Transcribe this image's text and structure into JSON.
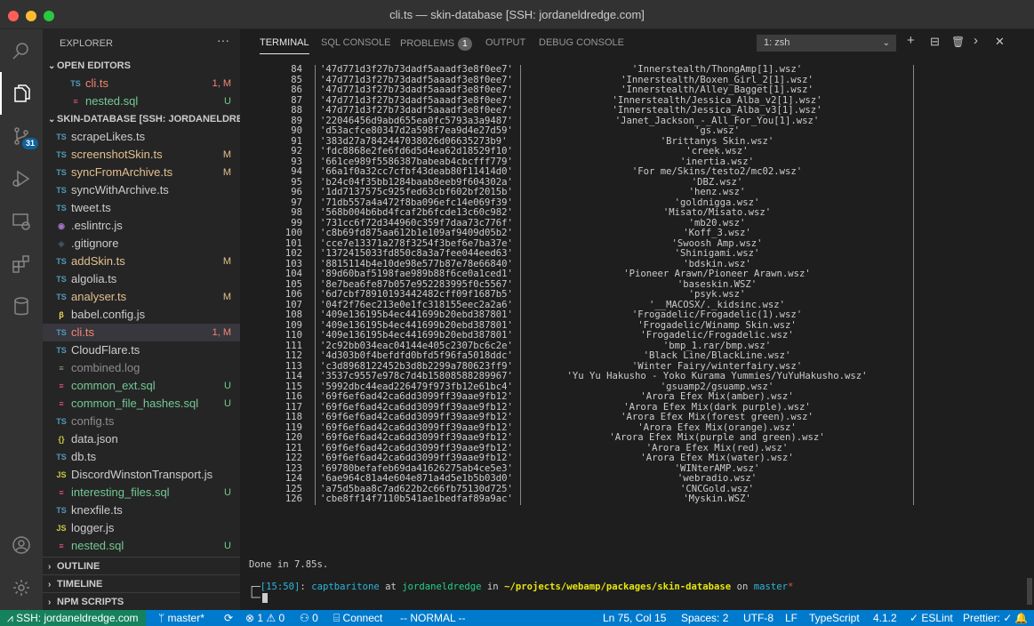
{
  "window": {
    "title": "cli.ts — skin-database [SSH: jordaneldredge.com]"
  },
  "activity_bar": {
    "scm_badge": "31"
  },
  "explorer": {
    "title": "EXPLORER",
    "more": "···",
    "open_editors_title": "OPEN EDITORS",
    "open_editors": [
      {
        "icon": "TS",
        "name": "cli.ts",
        "status": "1, M",
        "kind": "ts",
        "state": "err"
      },
      {
        "icon": "≡",
        "name": "nested.sql",
        "status": "U",
        "kind": "sql",
        "state": "unt"
      }
    ],
    "workspace_title": "SKIN-DATABASE [SSH: JORDANELDRE...",
    "files": [
      {
        "icon": "TS",
        "name": "scrapeLikes.ts",
        "status": "",
        "kind": "ts",
        "state": ""
      },
      {
        "icon": "TS",
        "name": "screenshotSkin.ts",
        "status": "M",
        "kind": "ts",
        "state": "mod"
      },
      {
        "icon": "TS",
        "name": "syncFromArchive.ts",
        "status": "M",
        "kind": "ts",
        "state": "mod"
      },
      {
        "icon": "TS",
        "name": "syncWithArchive.ts",
        "status": "",
        "kind": "ts",
        "state": ""
      },
      {
        "icon": "TS",
        "name": "tweet.ts",
        "status": "",
        "kind": "ts",
        "state": ""
      },
      {
        "icon": "◉",
        "name": ".eslintrc.js",
        "status": "",
        "kind": "esl",
        "state": ""
      },
      {
        "icon": "◈",
        "name": ".gitignore",
        "status": "",
        "kind": "git",
        "state": ""
      },
      {
        "icon": "TS",
        "name": "addSkin.ts",
        "status": "M",
        "kind": "ts",
        "state": "mod"
      },
      {
        "icon": "TS",
        "name": "algolia.ts",
        "status": "",
        "kind": "ts",
        "state": ""
      },
      {
        "icon": "TS",
        "name": "analyser.ts",
        "status": "M",
        "kind": "ts",
        "state": "mod"
      },
      {
        "icon": "β",
        "name": "babel.config.js",
        "status": "",
        "kind": "bab",
        "state": ""
      },
      {
        "icon": "TS",
        "name": "cli.ts",
        "status": "1, M",
        "kind": "ts",
        "state": "err",
        "selected": true
      },
      {
        "icon": "TS",
        "name": "CloudFlare.ts",
        "status": "",
        "kind": "ts",
        "state": ""
      },
      {
        "icon": "≡",
        "name": "combined.log",
        "status": "",
        "kind": "log",
        "state": "dim"
      },
      {
        "icon": "≡",
        "name": "common_ext.sql",
        "status": "U",
        "kind": "sql",
        "state": "unt"
      },
      {
        "icon": "≡",
        "name": "common_file_hashes.sql",
        "status": "U",
        "kind": "sql",
        "state": "unt"
      },
      {
        "icon": "TS",
        "name": "config.ts",
        "status": "",
        "kind": "ts",
        "state": "dim"
      },
      {
        "icon": "{}",
        "name": "data.json",
        "status": "",
        "kind": "json",
        "state": ""
      },
      {
        "icon": "TS",
        "name": "db.ts",
        "status": "",
        "kind": "ts",
        "state": ""
      },
      {
        "icon": "JS",
        "name": "DiscordWinstonTransport.js",
        "status": "",
        "kind": "js",
        "state": ""
      },
      {
        "icon": "≡",
        "name": "interesting_files.sql",
        "status": "U",
        "kind": "sql",
        "state": "unt"
      },
      {
        "icon": "TS",
        "name": "knexfile.ts",
        "status": "",
        "kind": "ts",
        "state": ""
      },
      {
        "icon": "JS",
        "name": "logger.js",
        "status": "",
        "kind": "js",
        "state": ""
      },
      {
        "icon": "≡",
        "name": "nested.sql",
        "status": "U",
        "kind": "sql",
        "state": "unt"
      }
    ],
    "outline_title": "OUTLINE",
    "timeline_title": "TIMELINE",
    "npm_title": "NPM SCRIPTS"
  },
  "panel": {
    "tabs": [
      {
        "label": "TERMINAL"
      },
      {
        "label": "SQL CONSOLE"
      },
      {
        "label": "PROBLEMS"
      },
      {
        "label": "OUTPUT"
      },
      {
        "label": "DEBUG CONSOLE"
      }
    ],
    "problems_count": "1",
    "shell": "1: zsh"
  },
  "terminal": {
    "rows": [
      {
        "n": "84",
        "h": "'47d771d3f27b73dadf5aaadf3e8f0ee7'",
        "f": "'Innerstealth/ThongAmp[1].wsz'"
      },
      {
        "n": "85",
        "h": "'47d771d3f27b73dadf5aaadf3e8f0ee7'",
        "f": "'Innerstealth/Boxen_Girl_2[1].wsz'"
      },
      {
        "n": "86",
        "h": "'47d771d3f27b73dadf5aaadf3e8f0ee7'",
        "f": "'Innerstealth/Alley_Bagget[1].wsz'"
      },
      {
        "n": "87",
        "h": "'47d771d3f27b73dadf5aaadf3e8f0ee7'",
        "f": "'Innerstealth/Jessica_Alba_v2[1].wsz'"
      },
      {
        "n": "88",
        "h": "'47d771d3f27b73dadf5aaadf3e8f0ee7'",
        "f": "'Innerstealth/Jessica_Alba_v3[1].wsz'"
      },
      {
        "n": "89",
        "h": "'22046456d9abd655ea0fc5793a3a9487'",
        "f": "'Janet_Jackson_-_All_For_You[1].wsz'"
      },
      {
        "n": "90",
        "h": "'d53acfce80347d2a598f7ea9d4e27d59'",
        "f": "'gs.wsz'"
      },
      {
        "n": "91",
        "h": "'383d27a7842447038026d06635273b9'",
        "f": "'Brittanys Skin.wsz'"
      },
      {
        "n": "92",
        "h": "'fdc8868e2fe6fd6d5d4ea62d18529f10'",
        "f": "'creek.wsz'"
      },
      {
        "n": "93",
        "h": "'661ce989f5586387babeab4cbcfff779'",
        "f": "'inertia.wsz'"
      },
      {
        "n": "94",
        "h": "'66a1f0a32cc7cfbf43deab80f11414d0'",
        "f": "'For me/Skins/testo2/mc02.wsz'"
      },
      {
        "n": "95",
        "h": "'b24c04f35bb1284baab8eeb9f604302a'",
        "f": "'DBZ.wsz'"
      },
      {
        "n": "96",
        "h": "'1dd7137575c925fed63cbf602bf2015b'",
        "f": "'henz.wsz'"
      },
      {
        "n": "97",
        "h": "'71db557a4a472f8ba096efc14e069f39'",
        "f": "'goldnigga.wsz'"
      },
      {
        "n": "98",
        "h": "'568b004b6bd4fcaf2b6fcde13c60c982'",
        "f": "'Misato/Misato.wsz'"
      },
      {
        "n": "99",
        "h": "'731cc6f72d344960c359f7daa73c776f'",
        "f": "'mb20.wsz'"
      },
      {
        "n": "100",
        "h": "'c8b69fd875aa612b1e109af9409d05b2'",
        "f": "'Koff_3.wsz'"
      },
      {
        "n": "101",
        "h": "'cce7e13371a278f3254f3bef6e7ba37e'",
        "f": "'Swoosh Amp.wsz'"
      },
      {
        "n": "102",
        "h": "'1372415033fd850c8a3a7fee044eed63'",
        "f": "'Shinigami.wsz'"
      },
      {
        "n": "103",
        "h": "'8815114b4e10de98e577b87e78e66840'",
        "f": "'bdskin.wsz'"
      },
      {
        "n": "104",
        "h": "'89d60baf5198fae989b88f6ce0a1ced1'",
        "f": "'Pioneer Arawn/Pioneer Arawn.wsz'"
      },
      {
        "n": "105",
        "h": "'8e7bea6fe87b057e952283995f0c5567'",
        "f": "'baseskin.WSZ'"
      },
      {
        "n": "106",
        "h": "'6d7cbf78910193442482cff09f1687b5'",
        "f": "'psyk.wsz'"
      },
      {
        "n": "107",
        "h": "'04f2f76ec213e0e1fc318155eec2a2a6'",
        "f": "'__MACOSX/._kidsinc.wsz'"
      },
      {
        "n": "108",
        "h": "'409e136195b4ec441699b20ebd387801'",
        "f": "'Frogadelic/Frogadelic(1).wsz'"
      },
      {
        "n": "109",
        "h": "'409e136195b4ec441699b20ebd387801'",
        "f": "'Frogadelic/Winamp Skin.wsz'"
      },
      {
        "n": "110",
        "h": "'409e136195b4ec441699b20ebd387801'",
        "f": "'Frogadelic/Frogadelic.wsz'"
      },
      {
        "n": "111",
        "h": "'2c92bb034eac04144e405c2307bc6c2e'",
        "f": "'bmp_1.rar/bmp.wsz'"
      },
      {
        "n": "112",
        "h": "'4d303b0f4befdfd0bfd5f96fa5018ddc'",
        "f": "'Black Line/BlackLine.wsz'"
      },
      {
        "n": "113",
        "h": "'c3d8968122452b3d8b2299a780623ff9'",
        "f": "'Winter Fairy/winterfairy.wsz'"
      },
      {
        "n": "114",
        "h": "'3537c9557e978c7d4b15808588289967'",
        "f": "'Yu Yu Hakusho - Yoko Kurama Yummies/YuYuHakusho.wsz'"
      },
      {
        "n": "115",
        "h": "'5992dbc44ead226479f973fb12e61bc4'",
        "f": "'gsuamp2/gsuamp.wsz'"
      },
      {
        "n": "116",
        "h": "'69f6ef6ad42ca6dd3099ff39aae9fb12'",
        "f": "'Arora Efex Mix(amber).wsz'"
      },
      {
        "n": "117",
        "h": "'69f6ef6ad42ca6dd3099ff39aae9fb12'",
        "f": "'Arora Efex Mix(dark purple).wsz'"
      },
      {
        "n": "118",
        "h": "'69f6ef6ad42ca6dd3099ff39aae9fb12'",
        "f": "'Arora Efex Mix(forest green).wsz'"
      },
      {
        "n": "119",
        "h": "'69f6ef6ad42ca6dd3099ff39aae9fb12'",
        "f": "'Arora Efex Mix(orange).wsz'"
      },
      {
        "n": "120",
        "h": "'69f6ef6ad42ca6dd3099ff39aae9fb12'",
        "f": "'Arora Efex Mix(purple and green).wsz'"
      },
      {
        "n": "121",
        "h": "'69f6ef6ad42ca6dd3099ff39aae9fb12'",
        "f": "'Arora Efex Mix(red).wsz'"
      },
      {
        "n": "122",
        "h": "'69f6ef6ad42ca6dd3099ff39aae9fb12'",
        "f": "'Arora Efex Mix(water).wsz'"
      },
      {
        "n": "123",
        "h": "'69780befafeb69da41626275ab4ce5e3'",
        "f": "'WINterAMP.wsz'"
      },
      {
        "n": "124",
        "h": "'6ae964c81a4e604e871a4d5e1b5b03d0'",
        "f": "'webradio.wsz'"
      },
      {
        "n": "125",
        "h": "'a75d5baa8c7ad622b2c66fb75130d725'",
        "f": "'CNCGold.wsz'"
      },
      {
        "n": "126",
        "h": "'cbe8ff14f7110b541ae1bedfaf89a9ac'",
        "f": "'Myskin.WSZ'"
      }
    ],
    "done": "Done in 7.85s.",
    "prompt": {
      "time": "[15:50]",
      "user": "captbaritone",
      "at": " at ",
      "host": "jordaneldredge",
      "in": " in ",
      "path": "~/projects/webamp/packages/skin-database",
      "on": " on ",
      "branch": "master",
      "dirty": "*"
    },
    "colors": {
      "time": "#29b8db",
      "user": "#29b8db",
      "host": "#23d18b",
      "path": "#e5e510",
      "branch": "#29b8db",
      "dirty": "#f14c4c"
    }
  },
  "status": {
    "remote": "SSH: jordaneldredge.com",
    "branch": "master*",
    "problems": "⊗ 1 ⚠ 0",
    "ports": "0",
    "connect": "Connect",
    "mode": "-- NORMAL --",
    "position": "Ln 75, Col 15",
    "spaces": "Spaces: 2",
    "encoding": "UTF-8",
    "eol": "LF",
    "language": "TypeScript",
    "version": "4.1.2",
    "eslint": "ESLint",
    "prettier": "Prettier:"
  }
}
